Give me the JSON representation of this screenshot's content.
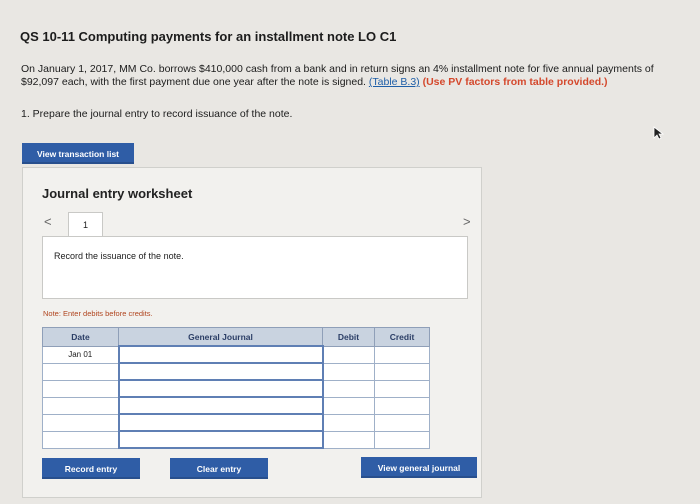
{
  "title": "QS 10-11 Computing payments for an installment note LO C1",
  "problem": {
    "text": "On January 1, 2017, MM Co. borrows $410,000 cash from a bank and in return signs an 4% installment note for five annual payments of $92,097 each, with the first payment due one year after the note is signed.",
    "table_link": "(Table B.3)",
    "pv_note": "(Use PV factors from table provided.)"
  },
  "step": "1. Prepare the journal entry to record issuance of the note.",
  "buttons": {
    "view_transaction_list": "View transaction list",
    "record_entry": "Record entry",
    "clear_entry": "Clear entry",
    "view_general_journal": "View general journal"
  },
  "worksheet": {
    "title": "Journal entry worksheet",
    "current_tab": "1",
    "prev_icon": "<",
    "next_icon": ">",
    "description": "Record the issuance of the note.",
    "note": "Note: Enter debits before credits."
  },
  "journal": {
    "headers": {
      "date": "Date",
      "general_journal": "General Journal",
      "debit": "Debit",
      "credit": "Credit"
    },
    "rows": [
      {
        "date": "Jan 01",
        "account": "",
        "debit": "",
        "credit": ""
      },
      {
        "date": "",
        "account": "",
        "debit": "",
        "credit": ""
      },
      {
        "date": "",
        "account": "",
        "debit": "",
        "credit": ""
      },
      {
        "date": "",
        "account": "",
        "debit": "",
        "credit": ""
      },
      {
        "date": "",
        "account": "",
        "debit": "",
        "credit": ""
      },
      {
        "date": "",
        "account": "",
        "debit": "",
        "credit": ""
      }
    ]
  },
  "colors": {
    "button_blue": "#2f5da6",
    "header_bg": "#c9d3e0",
    "link_blue": "#1f5fa8",
    "pv_red": "#d4482c",
    "note_red": "#b0451f"
  }
}
